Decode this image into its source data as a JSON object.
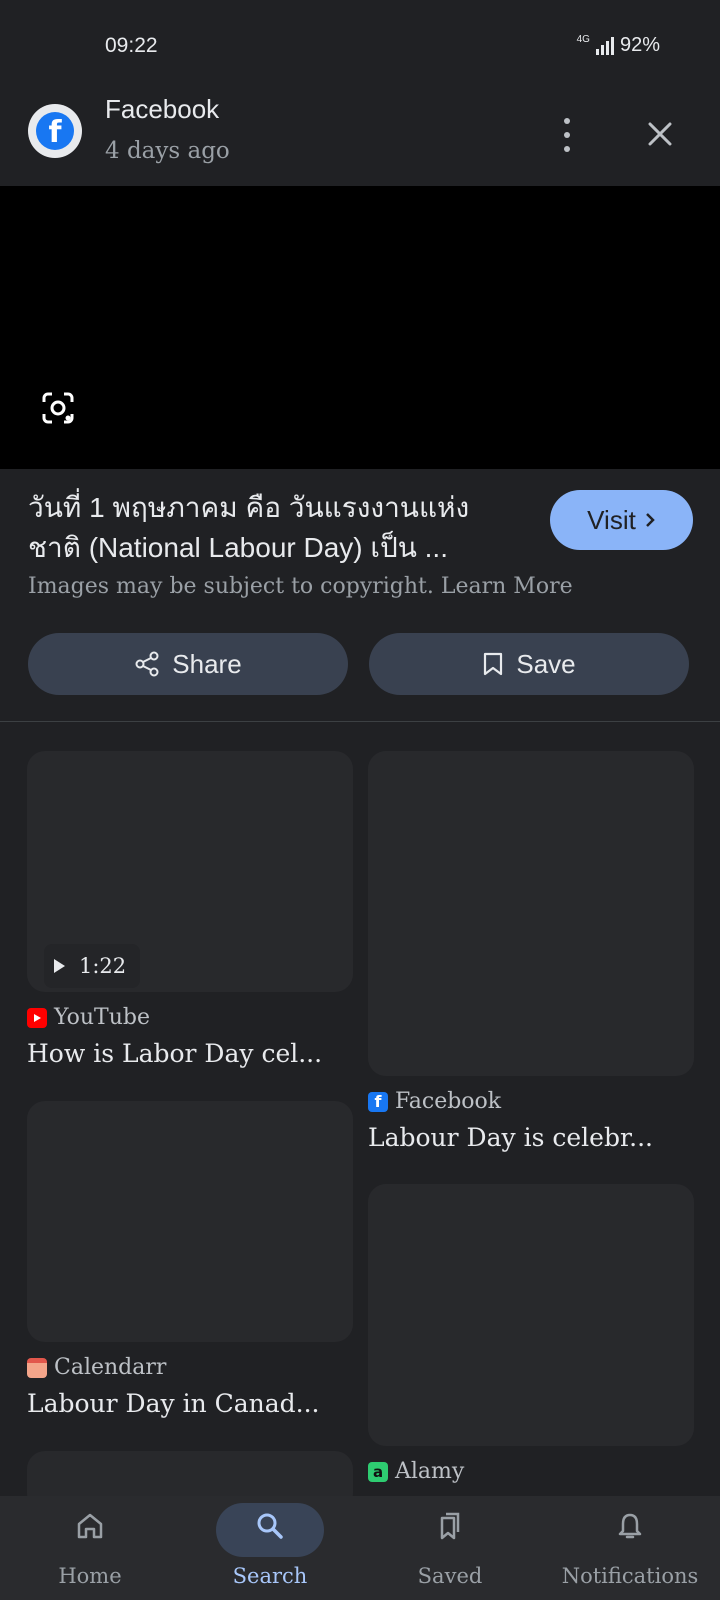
{
  "status": {
    "time": "09:22",
    "network": "4G",
    "battery": "92%"
  },
  "header": {
    "source": "Facebook",
    "time_ago": "4 days ago"
  },
  "caption": {
    "line1": "วันที่ 1 พฤษภาคม คือ วันแรงงานแห่ง",
    "line2": "ชาติ (National Labour Day) เป็น ...",
    "visit_label": "Visit",
    "copyright": "Images may be subject to copyright. Learn More"
  },
  "actions": {
    "share_label": "Share",
    "save_label": "Save"
  },
  "results": [
    {
      "source": "YouTube",
      "title": "How is Labor Day cel...",
      "duration": "1:22"
    },
    {
      "source": "Facebook",
      "title": "Labour Day is celebr..."
    },
    {
      "source": "Calendarr",
      "title": "Labour Day in Canad..."
    },
    {
      "source": "Alamy",
      "title": ""
    }
  ],
  "nav": [
    {
      "label": "Home",
      "icon": "home-icon"
    },
    {
      "label": "Search",
      "icon": "search-icon",
      "active": true
    },
    {
      "label": "Saved",
      "icon": "saved-icon"
    },
    {
      "label": "Notifications",
      "icon": "bell-icon"
    }
  ],
  "colors": {
    "accent": "#8ab4f8",
    "background": "#202124",
    "button": "#394150"
  }
}
